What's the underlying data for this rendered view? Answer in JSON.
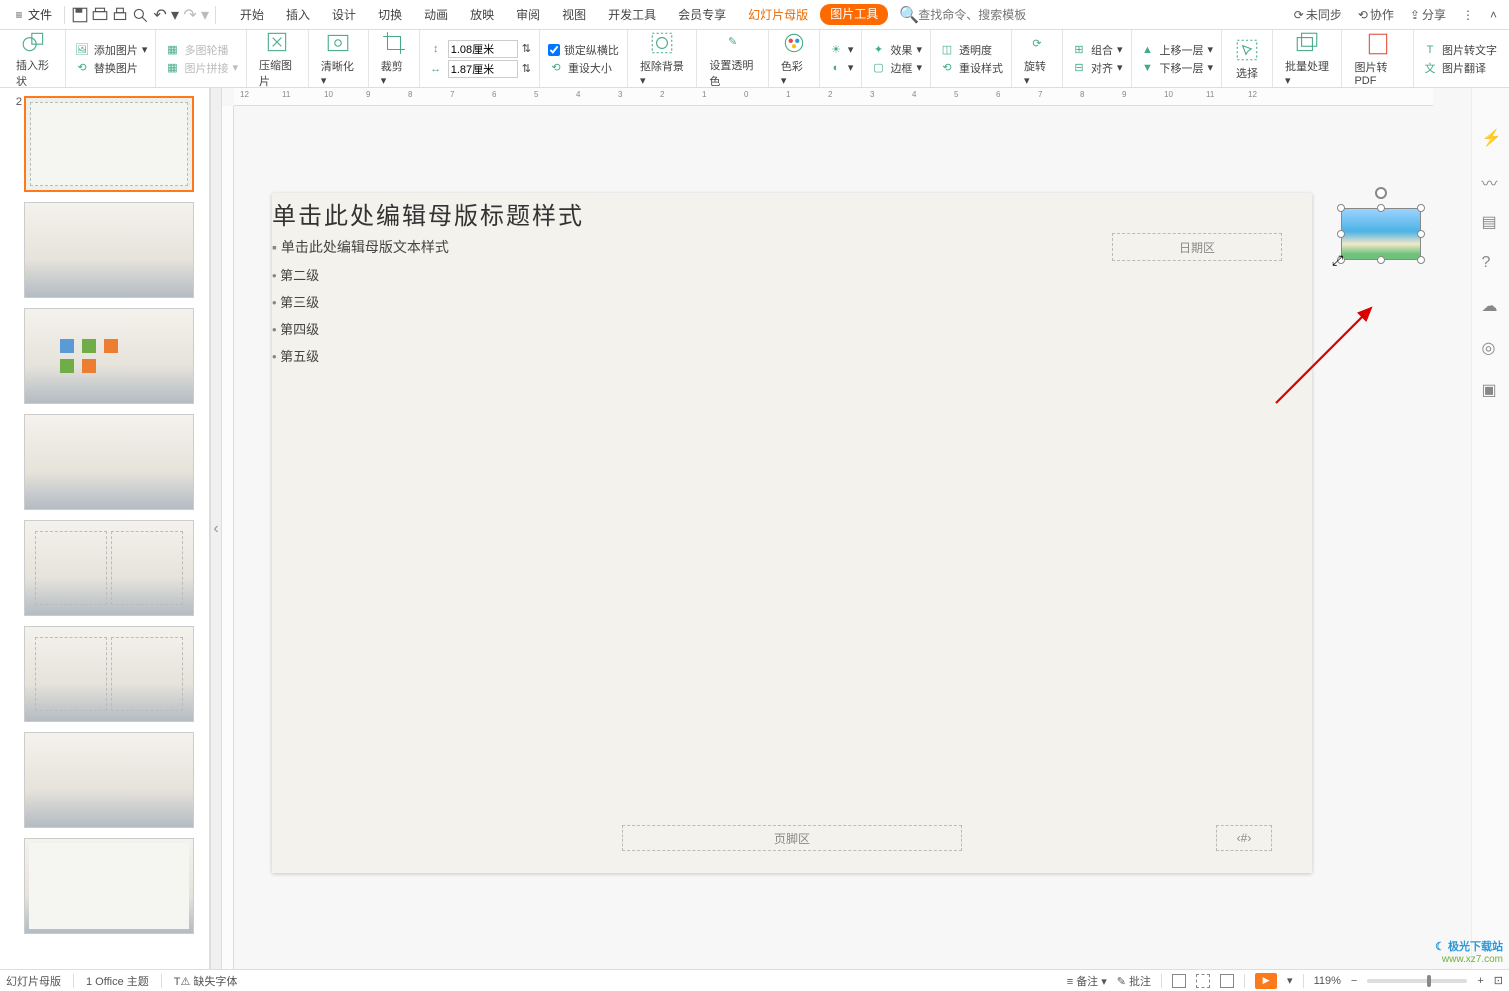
{
  "topbar": {
    "file_menu": "文件",
    "tabs": [
      "开始",
      "插入",
      "设计",
      "切换",
      "动画",
      "放映",
      "审阅",
      "视图",
      "开发工具",
      "会员专享"
    ],
    "context_tab_master": "幻灯片母版",
    "context_tab_picture": "图片工具",
    "search_placeholder": "查找命令、搜索模板",
    "unsynced": "未同步",
    "collaborate": "协作",
    "share": "分享"
  },
  "ribbon": {
    "insert_shape": "插入形状",
    "add_image": "添加图片",
    "multi_image_outline": "多图轮播",
    "replace_image": "替换图片",
    "image_collage": "图片拼接",
    "compress_image": "压缩图片",
    "sharpen": "清晰化",
    "crop": "裁剪",
    "height_label": "高",
    "height_value": "1.08厘米",
    "width_label": "宽",
    "width_value": "1.87厘米",
    "lock_aspect": "锁定纵横比",
    "reset_size": "重设大小",
    "remove_bg": "抠除背景",
    "set_transparent": "设置透明色",
    "color": "色彩",
    "effects": "效果",
    "transparency": "透明度",
    "border": "边框",
    "reset_style": "重设样式",
    "rotate": "旋转",
    "group": "组合",
    "align": "对齐",
    "bring_forward": "上移一层",
    "send_backward": "下移一层",
    "selection_pane": "选择",
    "batch_process": "批量处理",
    "to_pdf": "图片转PDF",
    "to_text": "图片转文字",
    "translate": "图片翻译"
  },
  "slide": {
    "title_placeholder": "单击此处编辑母版标题样式",
    "content_l1": "单击此处编辑母版文本样式",
    "content_l2": "第二级",
    "content_l3": "第三级",
    "content_l4": "第四级",
    "content_l5": "第五级",
    "date_placeholder": "日期区",
    "footer_placeholder": "页脚区",
    "number_placeholder": "‹#›"
  },
  "ruler_ticks": [
    "12",
    "11",
    "10",
    "9",
    "8",
    "7",
    "6",
    "5",
    "4",
    "3",
    "2",
    "1",
    "0",
    "1",
    "2",
    "3",
    "4",
    "5",
    "6",
    "7",
    "8",
    "9",
    "10",
    "11",
    "12"
  ],
  "status": {
    "master_view": "幻灯片母版",
    "theme": "1 Office 主题",
    "missing_font": "缺失字体",
    "notes": "备注",
    "comments": "批注",
    "zoom": "119%"
  },
  "thumbs": {
    "selected_index": "2"
  },
  "watermark": {
    "brand": "极光下载站",
    "url": "www.xz7.com"
  }
}
